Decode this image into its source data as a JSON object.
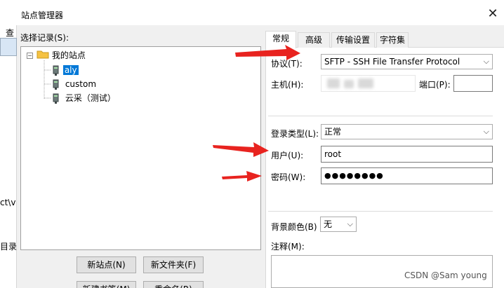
{
  "window": {
    "title": "站点管理器"
  },
  "background_app": {
    "menu_fragment": "查",
    "path_fragment": "ct\\v",
    "status_fragment": "目录。"
  },
  "tree": {
    "label": "选择记录(S):",
    "root": "我的站点",
    "items": [
      {
        "label": "aly",
        "selected": true
      },
      {
        "label": "custom",
        "selected": false
      },
      {
        "label": "云采（测试）",
        "selected": false
      }
    ]
  },
  "buttons": {
    "new_site": "新站点(N)",
    "new_folder": "新文件夹(F)",
    "new_bookmark": "新建书签(M)",
    "rename": "重命名(R)"
  },
  "tabs": [
    {
      "label": "常规",
      "active": true
    },
    {
      "label": "高级",
      "active": false
    },
    {
      "label": "传输设置",
      "active": false
    },
    {
      "label": "字符集",
      "active": false
    }
  ],
  "form": {
    "protocol_label": "协议(T):",
    "protocol_value": "SFTP - SSH File Transfer Protocol",
    "host_label": "主机(H):",
    "host_value": "",
    "port_label": "端口(P):",
    "port_value": "",
    "logon_type_label": "登录类型(L):",
    "logon_type_value": "正常",
    "user_label": "用户(U):",
    "user_value": "root",
    "password_label": "密码(W):",
    "password_value": "●●●●●●●●",
    "bg_color_label": "背景颜色(B)",
    "bg_color_value": "无",
    "comments_label": "注释(M):"
  },
  "watermark": "CSDN @Sam young",
  "colors": {
    "selection": "#0078d7",
    "annotation_arrow": "#e8231f",
    "folder": "#f5c242"
  },
  "icons": [
    "folder-icon",
    "server-icon",
    "close-icon",
    "dropdown-arrow-icon",
    "red-arrow-annotation"
  ]
}
